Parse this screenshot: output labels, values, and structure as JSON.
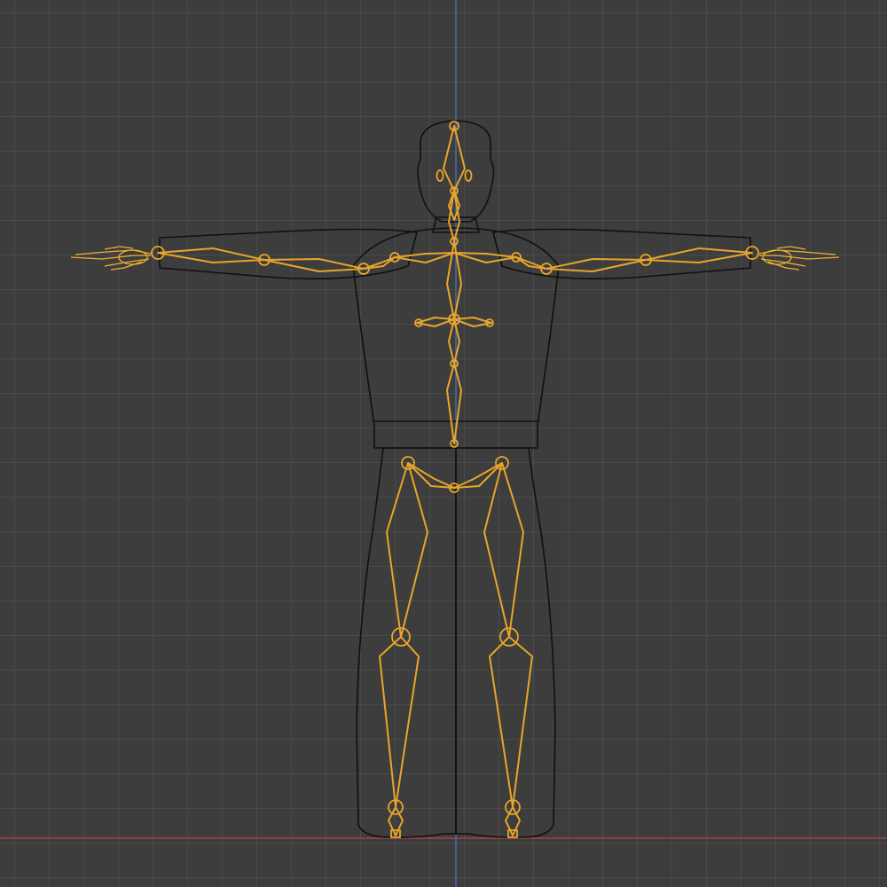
{
  "viewport": {
    "mode": "wireframe",
    "view": "front-orthographic",
    "grid": true,
    "axis_colors": {
      "z_axis": "#4a78c0",
      "x_axis": "#b04a4a"
    }
  },
  "colors": {
    "background": "#3d3d3d",
    "grid_line": "#4a4a4a",
    "mesh_wire": "#141414",
    "armature": "#e8a52b"
  },
  "objects": [
    {
      "name": "character-mesh",
      "type": "mesh",
      "display": "wire"
    },
    {
      "name": "armature",
      "type": "armature",
      "display": "octahedral",
      "selected": true
    }
  ]
}
